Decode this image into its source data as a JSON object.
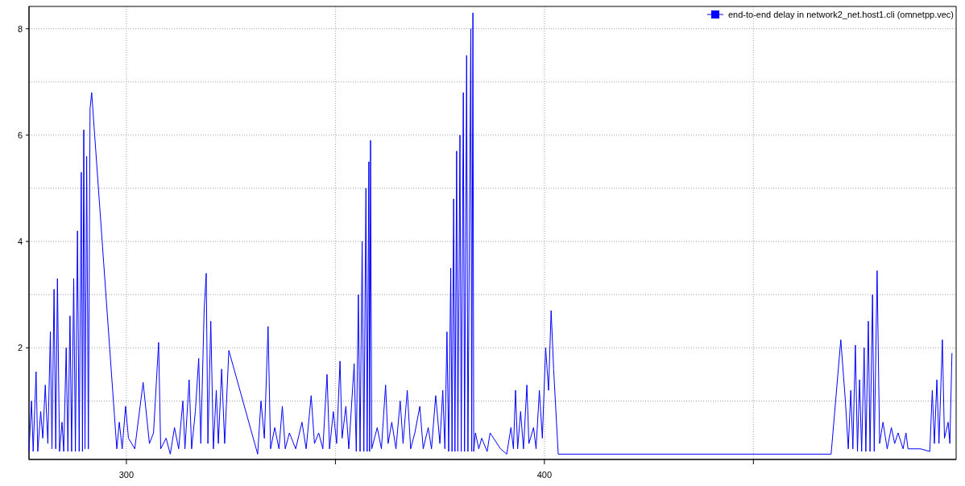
{
  "chart": {
    "chart_data": {
      "type": "line",
      "grid": true,
      "xlim": [
        276.7,
        498.5
      ],
      "ylim": [
        -0.1,
        8.42
      ],
      "xticks": [
        300,
        400
      ],
      "yticks": [
        2,
        4,
        6,
        8
      ],
      "x": [
        276.7,
        277.3,
        277.7,
        278.4,
        278.8,
        279.5,
        280,
        280.6,
        281.2,
        281.8,
        282.2,
        282.7,
        283.1,
        283.5,
        284,
        284.6,
        285,
        285.6,
        286,
        286.5,
        286.9,
        287.4,
        287.8,
        288.3,
        288.7,
        289.2,
        289.5,
        289.8,
        290.1,
        290.5,
        290.9,
        291.3,
        291.7,
        297.7,
        298.3,
        299,
        299.8,
        300.5,
        302,
        304,
        305.5,
        306.5,
        307.7,
        308.2,
        309.5,
        310.5,
        311.5,
        312.5,
        313.5,
        314,
        315,
        315.6,
        316.5,
        317.3,
        317.8,
        318.6,
        319.1,
        319.5,
        320.2,
        320.8,
        321.5,
        322,
        322.8,
        323.5,
        324.5,
        331.4,
        332.2,
        333,
        333.9,
        334.5,
        335.5,
        336.5,
        337.3,
        338,
        339,
        340.5,
        342,
        343,
        344.2,
        345,
        346,
        347,
        348,
        348.6,
        349.5,
        350.3,
        351.1,
        351.6,
        352.5,
        353.2,
        354.5,
        355,
        355.5,
        355.9,
        356.4,
        356.8,
        357.3,
        357.6,
        358,
        358.2,
        358.4,
        358.7,
        360,
        361,
        362,
        362.6,
        363.5,
        364.5,
        365.5,
        366.2,
        367.2,
        368,
        369,
        370.2,
        371,
        372.2,
        373,
        374,
        375,
        375.7,
        376.2,
        376.7,
        377.1,
        377.6,
        377.9,
        378.3,
        378.6,
        379,
        379.3,
        379.8,
        380.1,
        380.6,
        380.9,
        381.4,
        381.7,
        382.4,
        382.6,
        382.9,
        383.1,
        383.5,
        384.3,
        385,
        386.3,
        387,
        389.5,
        391,
        392,
        392.6,
        393.1,
        393.6,
        394.3,
        395,
        395.8,
        396.3,
        397.4,
        398,
        398.8,
        399.5,
        400.3,
        401,
        401.6,
        402.2,
        403.3,
        468.6,
        470.9,
        472,
        472.7,
        473.3,
        473.8,
        474.4,
        474.9,
        475.4,
        475.9,
        476.5,
        476.9,
        477.5,
        477.9,
        478.5,
        478.9,
        479.6,
        480.2,
        481,
        482,
        483,
        483.8,
        484.6,
        485.8,
        486.5,
        487,
        490,
        492.2,
        492.8,
        493.3,
        493.9,
        494.4,
        495.2,
        495.7,
        496.6,
        497,
        497.5
      ],
      "series": [
        {
          "name": "end-to-end delay in network2_net.host1.cli (omnetpp.vec)",
          "color": "#0000ff",
          "values": [
            0.05,
            1.0,
            0.05,
            1.55,
            0.05,
            0.8,
            0.3,
            1.3,
            0.2,
            2.3,
            0.1,
            3.1,
            0.1,
            3.3,
            0.05,
            0.6,
            0.05,
            2.0,
            0.05,
            2.6,
            0.05,
            3.3,
            0.05,
            4.2,
            0.05,
            5.3,
            0.05,
            6.1,
            0.1,
            5.6,
            0.1,
            6.5,
            6.8,
            0.1,
            0.6,
            0.1,
            0.9,
            0.3,
            0.1,
            1.35,
            0.2,
            0.4,
            2.1,
            0.1,
            0.3,
            0.0,
            0.5,
            0.1,
            1.0,
            0.1,
            1.4,
            0.1,
            0.8,
            1.8,
            0.2,
            2.7,
            3.4,
            0.2,
            2.5,
            0.1,
            1.2,
            0.2,
            1.6,
            0.2,
            1.95,
            0.0,
            1.0,
            0.3,
            2.4,
            0.1,
            0.5,
            0.1,
            0.9,
            0.1,
            0.4,
            0.1,
            0.6,
            0.1,
            1.1,
            0.2,
            0.4,
            0.1,
            1.5,
            0.1,
            0.8,
            0.2,
            1.75,
            0.3,
            0.9,
            0.1,
            1.7,
            0.05,
            3.0,
            0.05,
            4.0,
            0.05,
            5.0,
            0.05,
            5.5,
            0.05,
            5.9,
            0.1,
            0.5,
            0.1,
            1.3,
            0.2,
            0.6,
            0.1,
            1.0,
            0.2,
            1.2,
            0.1,
            0.4,
            0.9,
            0.1,
            0.5,
            0.1,
            1.1,
            0.2,
            1.2,
            0.1,
            2.3,
            0.05,
            3.5,
            0.05,
            4.8,
            0.05,
            5.7,
            0.05,
            6.0,
            0.05,
            6.8,
            0.05,
            7.5,
            0.05,
            8.0,
            0.05,
            8.3,
            0.05,
            0.4,
            0.1,
            0.3,
            0.05,
            0.4,
            0.1,
            0.0,
            0.5,
            0.1,
            1.2,
            0.1,
            0.8,
            0.1,
            1.3,
            0.2,
            0.5,
            0.1,
            1.2,
            0.3,
            2.0,
            1.2,
            2.7,
            1.6,
            0.0,
            0.0,
            2.15,
            1.0,
            0.1,
            1.2,
            0.1,
            2.05,
            0.05,
            1.4,
            0.05,
            2.0,
            0.05,
            2.5,
            0.05,
            3.0,
            0.05,
            3.45,
            0.2,
            0.6,
            0.1,
            0.5,
            0.2,
            0.4,
            0.1,
            0.4,
            0.1,
            0.1,
            0.05,
            1.2,
            0.2,
            1.4,
            0.2,
            2.15,
            0.3,
            0.6,
            0.2,
            1.9
          ]
        }
      ]
    }
  }
}
